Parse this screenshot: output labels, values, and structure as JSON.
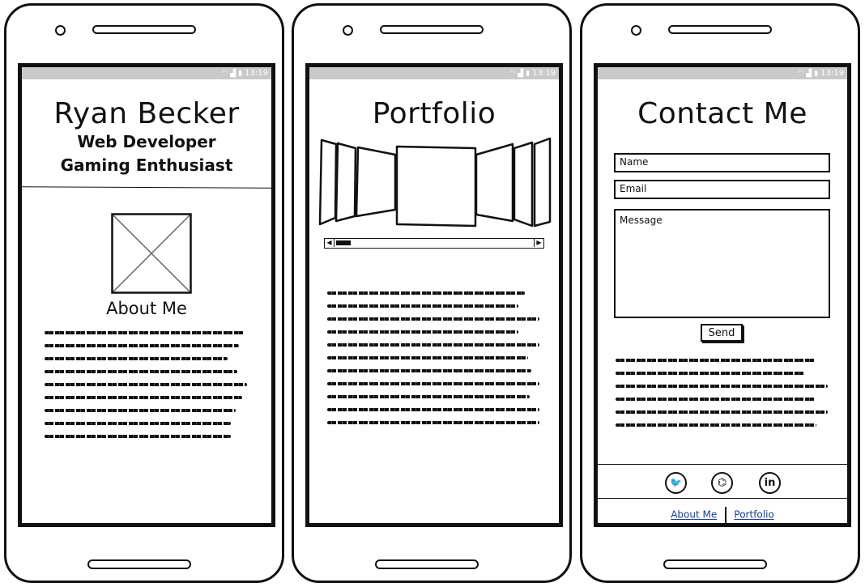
{
  "status_bar": {
    "time": "13:19",
    "wifi_icon": "wifi-icon",
    "signal_icon": "signal-icon",
    "battery_icon": "battery-icon"
  },
  "about_screen": {
    "name": "Ryan Becker",
    "tagline_1": "Web Developer",
    "tagline_2": "Gaming Enthusiast",
    "section_heading": "About Me",
    "image_icon": "image-placeholder-icon"
  },
  "portfolio_screen": {
    "title": "Portfolio",
    "carousel_icon": "cover-flow-carousel"
  },
  "contact_screen": {
    "title": "Contact Me",
    "name_placeholder": "Name",
    "email_placeholder": "Email",
    "message_placeholder": "Message",
    "send_label": "Send",
    "social": [
      {
        "icon": "twitter-icon",
        "glyph": "🐦"
      },
      {
        "icon": "github-icon",
        "glyph": "⌬"
      },
      {
        "icon": "linkedin-icon",
        "glyph": "in"
      }
    ],
    "footer_links": [
      "About Me",
      "Portfolio"
    ]
  }
}
